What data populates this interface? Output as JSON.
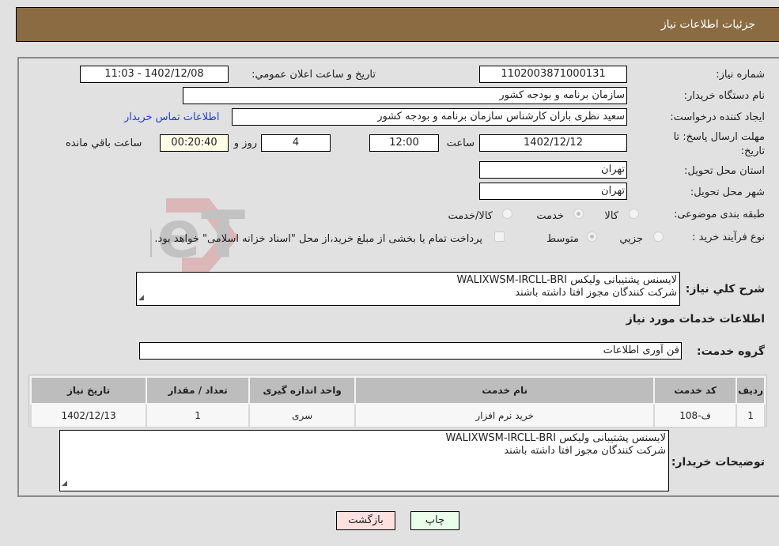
{
  "header": {
    "title": "جزئیات اطلاعات نیاز"
  },
  "fields": {
    "need_number_label": "شماره نیاز:",
    "need_number": "1102003871000131",
    "announce_label": "تاریخ و ساعت اعلان عمومي:",
    "announce_value": "1402/12/08 - 11:03",
    "buyer_org_label": "نام دستگاه خریدار:",
    "buyer_org": "سازمان برنامه و بودجه کشور",
    "creator_label": "ایجاد کننده درخواست:",
    "creator": "سعید نظری باران کارشناس سازمان برنامه و بودجه کشور",
    "buyer_contact_link": "اطلاعات تماس خریدار",
    "deadline_label_1": "مهلت ارسال پاسخ: تا",
    "deadline_label_2": "تاریخ:",
    "deadline_date": "1402/12/12",
    "time_label": "ساعت",
    "deadline_time": "12:00",
    "days_value": "4",
    "days_label": "روز و",
    "remaining_value": "00:20:40",
    "remaining_label": "ساعت باقي مانده",
    "province_label": "استان محل تحویل:",
    "province": "تهران",
    "city_label": "شهر محل تحویل:",
    "city": "تهران",
    "category_label": "طبقه بندی موضوعی:",
    "category_options": [
      "کالا",
      "خدمت",
      "کالا/خدمت"
    ],
    "category_selected": "خدمت",
    "process_label": "نوع فرآیند خرید :",
    "process_options": [
      "جزيي",
      "متوسط"
    ],
    "process_selected": "متوسط",
    "treasury_note": "پرداخت تمام یا بخشی از مبلغ خرید،از محل \"اسناد خزانه اسلامی\" خواهد بود."
  },
  "description": {
    "label": "شرح کلي نیاز:",
    "line1": "لایسنس پشتیبانی ولیکس WALIXWSM-IRCLL-BRI",
    "line2": "شرکت کنندگان مجوز افتا داشته باشند"
  },
  "services": {
    "section_title": "اطلاعات خدمات مورد نیاز",
    "group_label": "گروه خدمت:",
    "group_value": "فن آوری اطلاعات",
    "columns": [
      "ردیف",
      "کد خدمت",
      "نام خدمت",
      "واحد اندازه گیری",
      "تعداد / مقدار",
      "تاریخ نیاز"
    ],
    "rows": [
      {
        "index": "1",
        "code": "ف-108",
        "name": "خرید نرم افزار",
        "unit": "سری",
        "qty": "1",
        "date": "1402/12/13"
      }
    ]
  },
  "buyer_notes": {
    "label": "توضیحات خریدار:",
    "line1": "لایسنس پشتیبانی ولیکس WALIXWSM-IRCLL-BRI",
    "line2": "شرکت کنندگان مجوز افتا داشته باشند"
  },
  "buttons": {
    "print": "چاپ",
    "back": "بازگشت"
  },
  "watermark": {
    "text": "AriaTender.neT"
  },
  "colors": {
    "header": "#8b6c42",
    "print_bg": "#eaffea",
    "back_bg": "#ffe0e0",
    "remaining_bg": "#fffde8"
  }
}
